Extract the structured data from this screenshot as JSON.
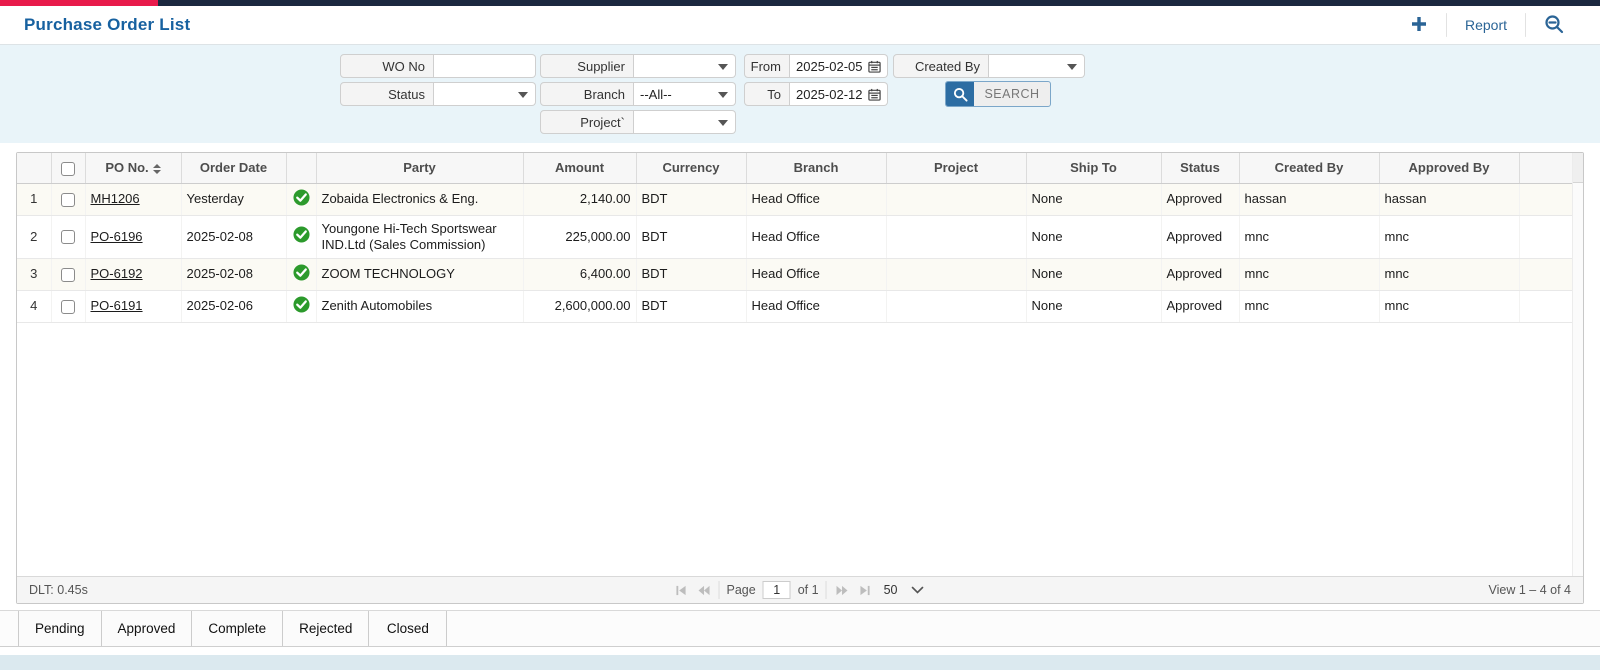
{
  "header": {
    "title": "Purchase Order List",
    "report_label": "Report",
    "icons": {
      "add": "plus-icon",
      "zoom": "zoom-out-icon"
    }
  },
  "filters": {
    "wo_no": {
      "label": "WO No",
      "value": ""
    },
    "status": {
      "label": "Status",
      "value": ""
    },
    "supplier": {
      "label": "Supplier",
      "value": ""
    },
    "branch": {
      "label": "Branch",
      "value": "--All--"
    },
    "project": {
      "label": "Project`",
      "value": ""
    },
    "from": {
      "label": "From",
      "value": "2025-02-05"
    },
    "to": {
      "label": "To",
      "value": "2025-02-12"
    },
    "created_by": {
      "label": "Created By",
      "value": ""
    },
    "search_label": "SEARCH"
  },
  "table": {
    "columns": [
      "",
      "",
      "PO No.",
      "Order Date",
      "",
      "Party",
      "Amount",
      "Currency",
      "Branch",
      "Project",
      "Ship To",
      "Status",
      "Created By",
      "Approved By"
    ],
    "rows": [
      {
        "num": "1",
        "po_no": "MH1206",
        "order_date": "Yesterday",
        "party": "Zobaida Electronics & Eng.",
        "amount": "2,140.00",
        "currency": "BDT",
        "branch": "Head Office",
        "project": "",
        "ship_to": "None",
        "status": "Approved",
        "created_by": "hassan",
        "approved_by": "hassan"
      },
      {
        "num": "2",
        "po_no": "PO-6196",
        "order_date": "2025-02-08",
        "party": "Youngone Hi-Tech Sportswear IND.Ltd (Sales Commission)",
        "amount": "225,000.00",
        "currency": "BDT",
        "branch": "Head Office",
        "project": "",
        "ship_to": "None",
        "status": "Approved",
        "created_by": "mnc",
        "approved_by": "mnc"
      },
      {
        "num": "3",
        "po_no": "PO-6192",
        "order_date": "2025-02-08",
        "party": "ZOOM TECHNOLOGY",
        "amount": "6,400.00",
        "currency": "BDT",
        "branch": "Head Office",
        "project": "",
        "ship_to": "None",
        "status": "Approved",
        "created_by": "mnc",
        "approved_by": "mnc"
      },
      {
        "num": "4",
        "po_no": "PO-6191",
        "order_date": "2025-02-06",
        "party": "Zenith Automobiles",
        "amount": "2,600,000.00",
        "currency": "BDT",
        "branch": "Head Office",
        "project": "",
        "ship_to": "None",
        "status": "Approved",
        "created_by": "mnc",
        "approved_by": "mnc"
      }
    ]
  },
  "footer": {
    "dlt": "DLT: 0.45s",
    "page_label": "Page",
    "page_value": "1",
    "of_label": "of 1",
    "page_size": "50",
    "view_info": "View 1 – 4 of 4"
  },
  "tabs": [
    "Pending",
    "Approved",
    "Complete",
    "Rejected",
    "Closed"
  ],
  "colors": {
    "accent_blue": "#2a6496",
    "title_blue": "#1761a0",
    "bar_red": "#e81a4b",
    "bar_navy": "#1b2840",
    "approved_green": "#2c9a2c"
  }
}
